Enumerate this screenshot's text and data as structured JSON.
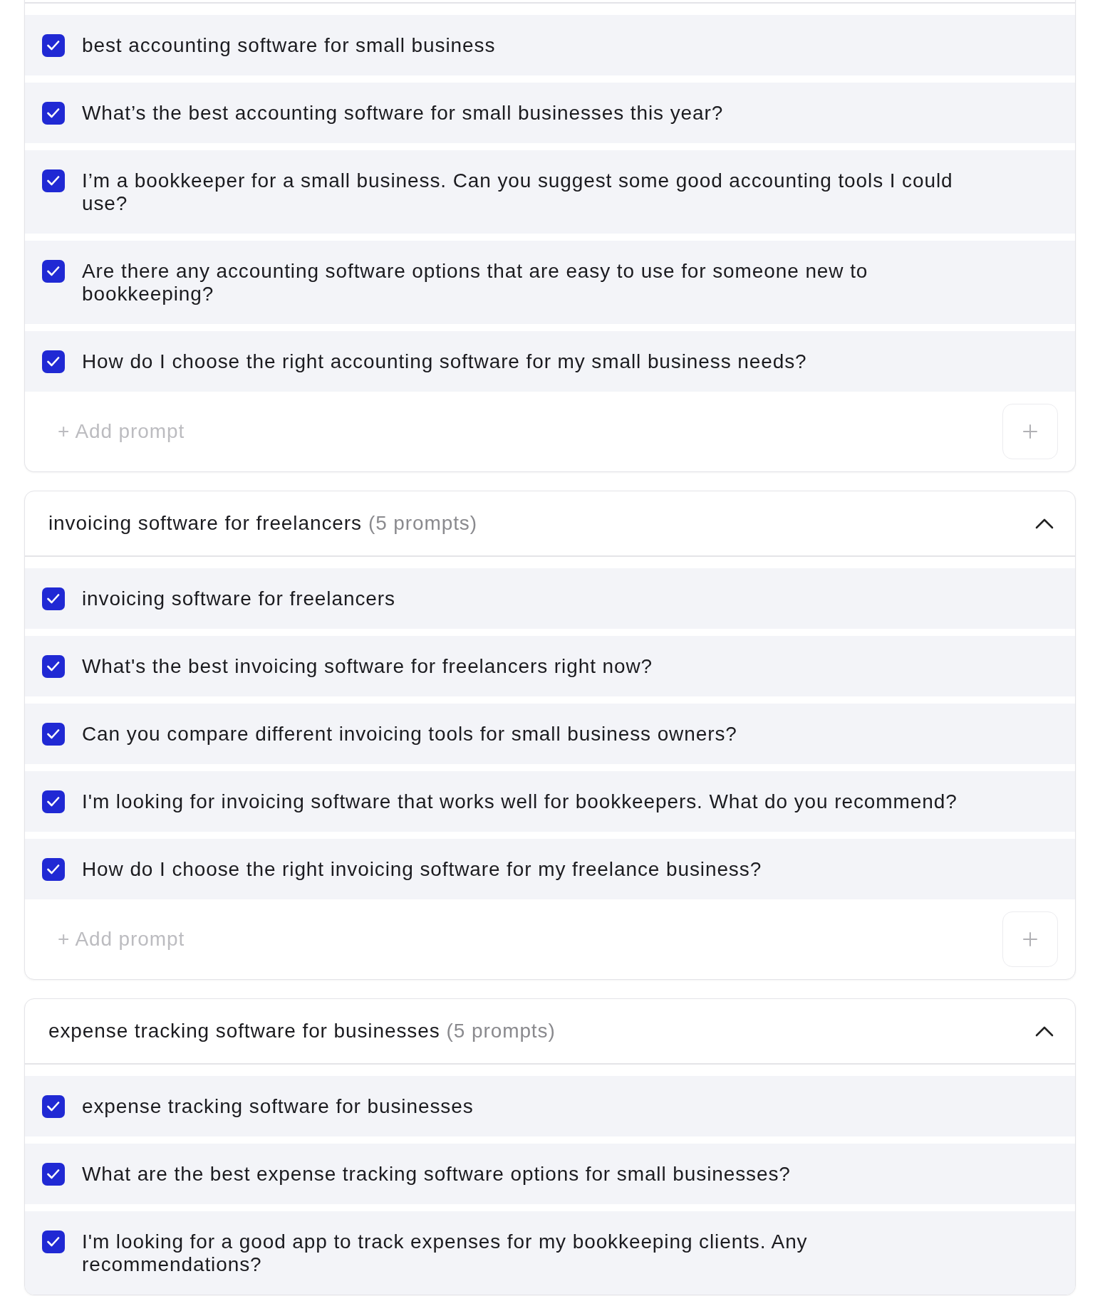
{
  "groups": [
    {
      "prompts": [
        {
          "text": "best accounting software for small business",
          "checked": true
        },
        {
          "text": "What’s the best accounting software for small businesses this year?",
          "checked": true
        },
        {
          "text": "I’m a bookkeeper for a small business. Can you suggest some good accounting tools I could use?",
          "checked": true
        },
        {
          "text": "Are there any accounting software options that are easy to use for someone new to bookkeeping?",
          "checked": true
        },
        {
          "text": "How do I choose the right accounting software for my small business needs?",
          "checked": true
        }
      ],
      "add_placeholder": "+ Add prompt"
    },
    {
      "title": "invoicing software for freelancers",
      "count": "(5 prompts)",
      "expanded": true,
      "prompts": [
        {
          "text": "invoicing software for freelancers",
          "checked": true
        },
        {
          "text": "What's the best invoicing software for freelancers right now?",
          "checked": true
        },
        {
          "text": "Can you compare different invoicing tools for small business owners?",
          "checked": true
        },
        {
          "text": "I'm looking for invoicing software that works well for bookkeepers. What do you recommend?",
          "checked": true
        },
        {
          "text": "How do I choose the right invoicing software for my freelance business?",
          "checked": true
        }
      ],
      "add_placeholder": "+ Add prompt"
    },
    {
      "title": "expense tracking software for businesses",
      "count": "(5 prompts)",
      "expanded": true,
      "prompts": [
        {
          "text": "expense tracking software for businesses",
          "checked": true
        },
        {
          "text": "What are the best expense tracking software options for small businesses?",
          "checked": true
        },
        {
          "text": "I'm looking for a good app to track expenses for my bookkeeping clients. Any recommendations?",
          "checked": true
        }
      ]
    }
  ]
}
